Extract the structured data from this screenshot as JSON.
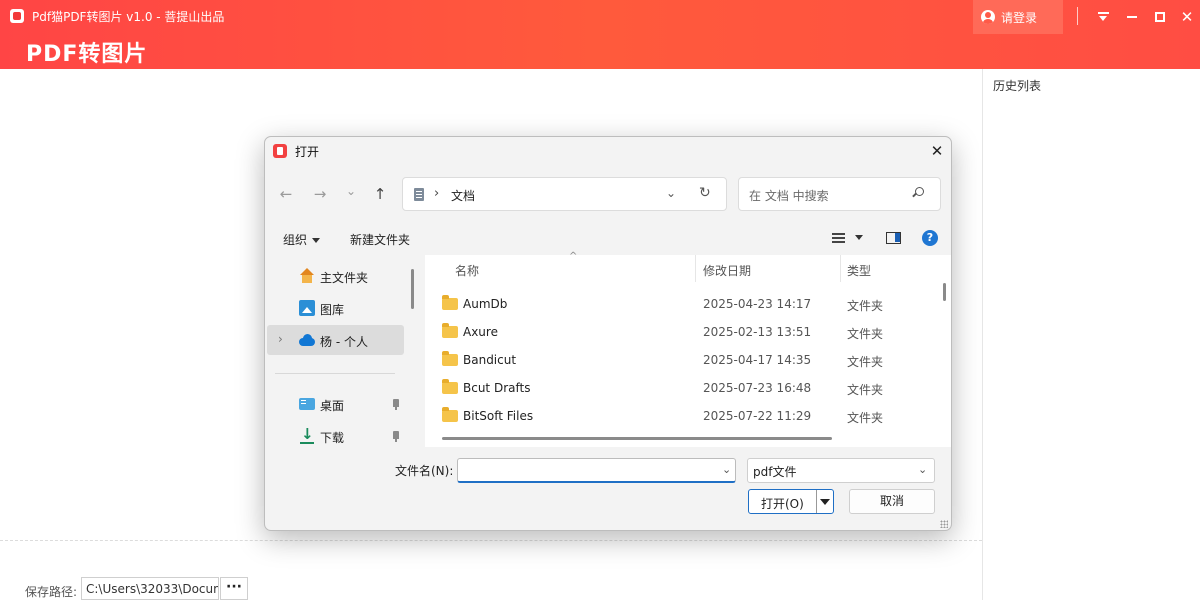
{
  "app": {
    "title": "Pdf猫PDF转图片 v1.0 - 菩提山出品",
    "big_title": "PDF转图片",
    "login_label": "请登录",
    "history_title": "历史列表",
    "save_label": "保存路径:",
    "save_path": "C:\\Users\\32033\\Docum",
    "more_label": "···",
    "icons": [
      "app-logo-icon",
      "user-icon",
      "menu-icon",
      "minimize-icon",
      "maximize-icon",
      "close-icon"
    ],
    "accent_color": "#ff4d43"
  },
  "dialog": {
    "title": "打开",
    "close_glyph": "✕",
    "nav": {
      "back": "←",
      "forward": "→",
      "recent": "⌄",
      "up": "↑"
    },
    "address": {
      "chevron": "›",
      "path": "文档",
      "dropdown": "⌄",
      "refresh": "↻"
    },
    "search_placeholder": "在 文档 中搜索",
    "toolbar": {
      "organize": "组织",
      "new_folder": "新建文件夹",
      "help": "?"
    },
    "nav_pane": {
      "expand_glyph": "›",
      "items": [
        {
          "label": "主文件夹",
          "icon": "home-icon"
        },
        {
          "label": "图库",
          "icon": "gallery-icon"
        },
        {
          "label": "杨 - 个人",
          "icon": "onedrive-icon"
        },
        {
          "label": "桌面",
          "icon": "desktop-icon",
          "pinned": true
        },
        {
          "label": "下载",
          "icon": "download-icon",
          "pinned": true
        }
      ]
    },
    "columns": {
      "name": "名称",
      "date": "修改日期",
      "type": "类型",
      "sort_glyph": "^"
    },
    "files": [
      {
        "name": "AumDb",
        "date": "2025-04-23 14:17",
        "type": "文件夹"
      },
      {
        "name": "Axure",
        "date": "2025-02-13 13:51",
        "type": "文件夹"
      },
      {
        "name": "Bandicut",
        "date": "2025-04-17 14:35",
        "type": "文件夹"
      },
      {
        "name": "Bcut Drafts",
        "date": "2025-07-23 16:48",
        "type": "文件夹"
      },
      {
        "name": "BitSoft Files",
        "date": "2025-07-22 11:29",
        "type": "文件夹"
      }
    ],
    "filename": {
      "label": "文件名(N):",
      "value": "",
      "dropdown": "⌄"
    },
    "filetype": {
      "value": "pdf文件",
      "dropdown": "⌄"
    },
    "buttons": {
      "open": "打开(O)",
      "cancel": "取消"
    },
    "highlight_color": "#1f6fc5"
  }
}
